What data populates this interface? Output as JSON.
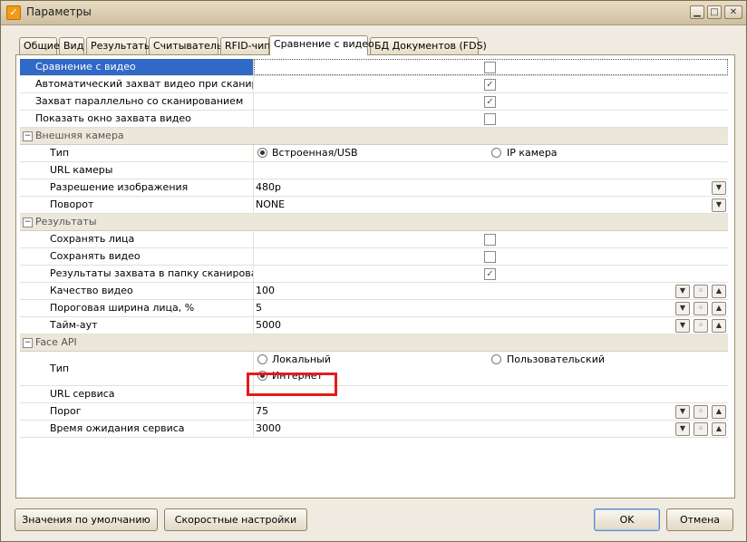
{
  "window": {
    "title": "Параметры"
  },
  "tabs": [
    "Общие",
    "Вид",
    "Результаты",
    "Считыватель",
    "RFID-чип",
    "Сравнение с видео",
    "БД Документов (FDS)"
  ],
  "general": {
    "compare_video": "Сравнение с видео",
    "auto_capture": "Автоматический захват видео при сканиро...",
    "capture_parallel": "Захват параллельно со сканированием",
    "show_capture_window": "Показать окно захвата видео",
    "checks": [
      false,
      true,
      true,
      false
    ]
  },
  "external_camera": {
    "title": "Внешняя камера",
    "type_label": "Тип",
    "type_option_builtin": "Встроенная/USB",
    "type_option_ip": "IP камера",
    "url_label": "URL камеры",
    "resolution_label": "Разрешение изображения",
    "resolution_value": "480p",
    "rotation_label": "Поворот",
    "rotation_value": "NONE"
  },
  "results": {
    "title": "Результаты",
    "save_faces": "Сохранять лица",
    "save_video": "Сохранять видео",
    "results_folder": "Результаты захвата в папку сканирова...",
    "checks": [
      false,
      false,
      true
    ],
    "video_quality_label": "Качество видео",
    "video_quality_value": "100",
    "face_width_label": "Пороговая ширина лица, %",
    "face_width_value": "5",
    "timeout_label": "Тайм-аут",
    "timeout_value": "5000"
  },
  "face_api": {
    "title": "Face API",
    "type_label": "Тип",
    "opt_local": "Локальный",
    "opt_custom": "Пользовательский",
    "opt_internet": "Интернет",
    "url_label": "URL сервиса",
    "threshold_label": "Порог",
    "threshold_value": "75",
    "wait_label": "Время ожидания сервиса",
    "wait_value": "3000"
  },
  "buttons": {
    "defaults": "Значения по умолчанию",
    "speed": "Скоростные настройки",
    "ok": "OK",
    "cancel": "Отмена"
  },
  "colors": {
    "selection": "#3169c6",
    "highlight_box": "#e61a1a"
  }
}
